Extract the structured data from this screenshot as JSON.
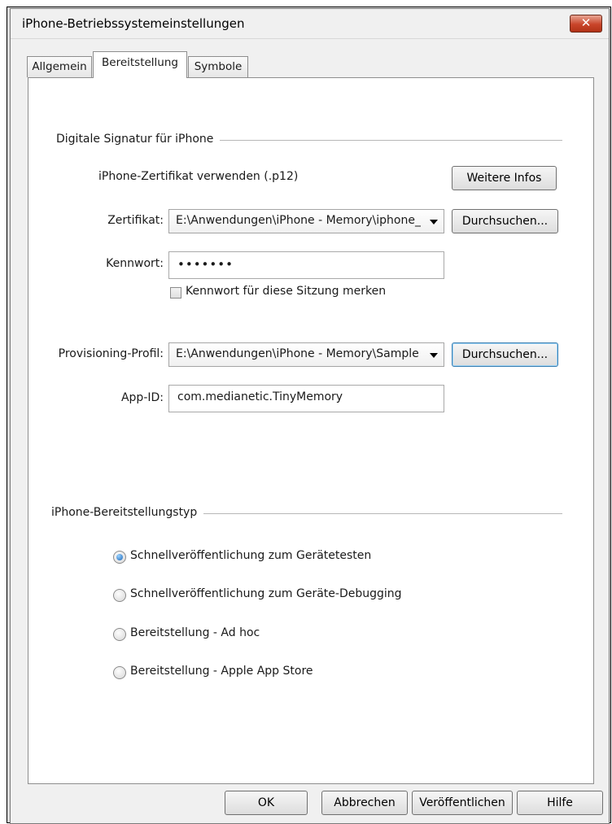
{
  "window": {
    "title": "iPhone-Betriebssystemeinstellungen",
    "close_glyph": "✕"
  },
  "tabs": [
    {
      "label": "Allgemein",
      "active": false
    },
    {
      "label": "Bereitstellung",
      "active": true
    },
    {
      "label": "Symbole",
      "active": false
    }
  ],
  "signature_group": {
    "title": "Digitale Signatur für iPhone",
    "use_cert_label": "iPhone-Zertifikat verwenden (.p12)",
    "more_info_label": "Weitere Infos",
    "certificate_label": "Zertifikat:",
    "certificate_value": "E:\\Anwendungen\\iPhone - Memory\\iphone_",
    "browse_label": "Durchsuchen...",
    "password_label": "Kennwort:",
    "password_value": "•••••••",
    "remember_label": "Kennwort für diese Sitzung merken",
    "remember_checked": false,
    "profile_label": "Provisioning-Profil:",
    "profile_value": "E:\\Anwendungen\\iPhone - Memory\\Sample",
    "appid_label": "App-ID:",
    "appid_value": "com.medianetic.TinyMemory"
  },
  "deploy_group": {
    "title": "iPhone-Bereitstellungstyp",
    "options": [
      {
        "label": "Schnellveröffentlichung zum Gerätetesten",
        "checked": true
      },
      {
        "label": "Schnellveröffentlichung zum Geräte-Debugging",
        "checked": false
      },
      {
        "label": "Bereitstellung - Ad hoc",
        "checked": false
      },
      {
        "label": "Bereitstellung - Apple App Store",
        "checked": false
      }
    ]
  },
  "footer": {
    "ok": "OK",
    "cancel": "Abbrechen",
    "publish": "Veröffentlichen",
    "help": "Hilfe"
  },
  "colors": {
    "accent": "#1d67b8",
    "close_red": "#c9452a"
  }
}
